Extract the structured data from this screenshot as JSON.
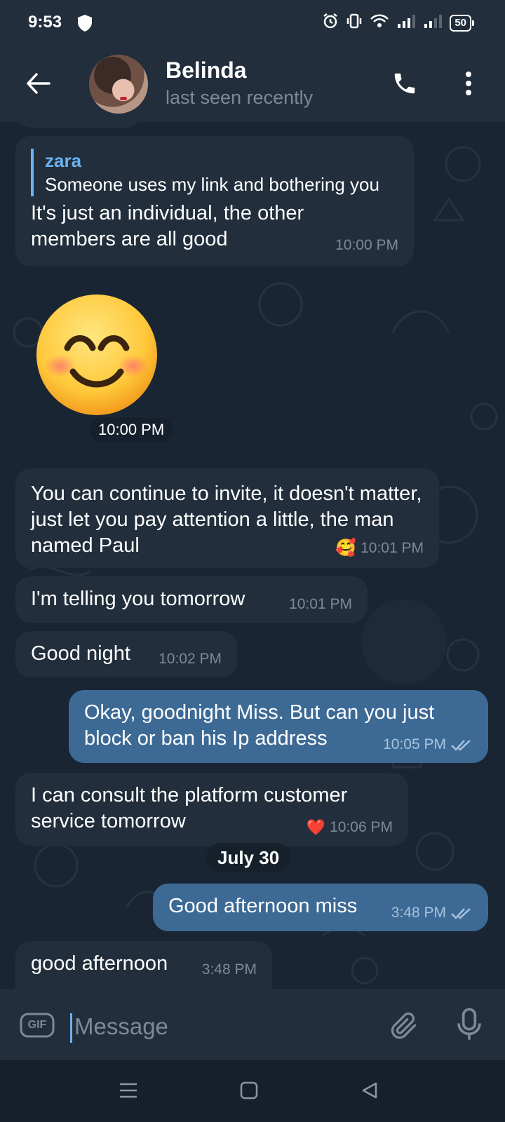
{
  "status_bar": {
    "time": "9:53",
    "battery": "50"
  },
  "header": {
    "name": "Belinda",
    "status": "last seen recently"
  },
  "messages": {
    "m1": {
      "reply_author": "zara",
      "reply_text": "Someone uses my link and bothering you",
      "text": "It's just an individual, the other members are all good",
      "time": "10:00 PM"
    },
    "m2": {
      "emoji": "😊",
      "time": "10:00 PM"
    },
    "m3": {
      "text": "You can continue to invite, it doesn't matter, just let you pay attention a little, the man named Paul",
      "reaction": "🥰",
      "time": "10:01 PM"
    },
    "m4": {
      "text": "I'm telling you tomorrow",
      "time": "10:01 PM"
    },
    "m5": {
      "text": "Good night",
      "time": "10:02 PM"
    },
    "m6": {
      "text": "Okay, goodnight Miss. But can you just block or ban his Ip address",
      "time": "10:05 PM",
      "read": true
    },
    "m7": {
      "text": "I can consult the platform customer service tomorrow",
      "reaction": "❤️",
      "time": "10:06 PM"
    },
    "m8": {
      "text": "Good afternoon miss",
      "time": "3:48 PM",
      "read": true
    },
    "m9": {
      "text": "good afternoon",
      "time": "3:48 PM"
    }
  },
  "date_separator": "July 30",
  "input": {
    "placeholder": "Message",
    "gif_label": "GIF"
  },
  "colors": {
    "incoming": "#222e3b",
    "outgoing": "#3d6a95",
    "accent": "#6ab2f2",
    "background": "#1a2533"
  },
  "icons": [
    "back-arrow-icon",
    "phone-icon",
    "more-vertical-icon",
    "gif-icon",
    "paperclip-icon",
    "microphone-icon",
    "double-check-icon"
  ]
}
